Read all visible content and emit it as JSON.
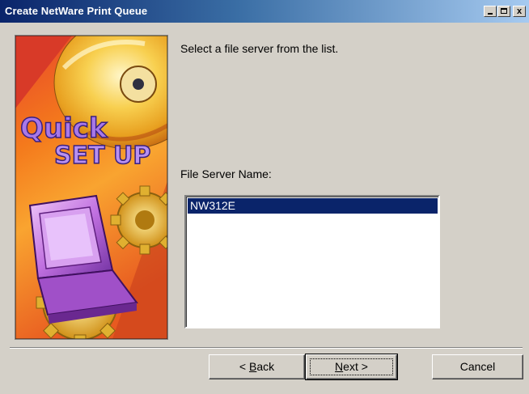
{
  "window": {
    "title": "Create NetWare Print Queue",
    "controls": {
      "minimize": "_",
      "maximize": "□",
      "close": "x"
    }
  },
  "sidebar_image": {
    "name": "quick-setup-banner",
    "text_line1": "Quick",
    "text_line2": "SET UP"
  },
  "content": {
    "instruction": "Select a file server from the list.",
    "file_server_label": "File Server Name:",
    "file_servers": [
      {
        "name": "NW312E",
        "selected": true
      }
    ]
  },
  "buttons": {
    "back": {
      "prefix": "< ",
      "mnemonic": "B",
      "rest": "ack"
    },
    "next": {
      "mnemonic": "N",
      "rest": "ext",
      "suffix": " >"
    },
    "cancel": "Cancel"
  },
  "colors": {
    "dialog_bg": "#d4d0c8",
    "title_start": "#0a246a",
    "title_end": "#a6caf0",
    "selection": "#0a246a"
  }
}
